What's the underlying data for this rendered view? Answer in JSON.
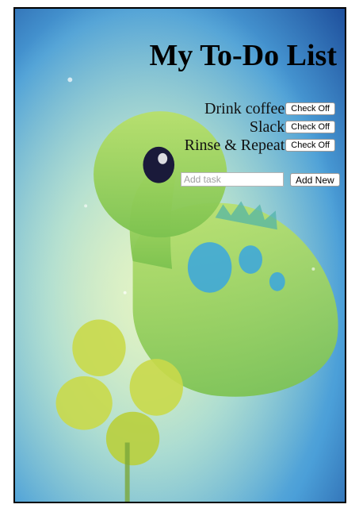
{
  "page": {
    "title": "My To-Do List",
    "background_colors": {
      "sky_light": "#cfe9b8",
      "sky_mid": "#8fd0d6",
      "sky_blue": "#4b9fd8",
      "sky_dark": "#1e4f9c",
      "dinosaur_green": "#a9d85a",
      "dinosaur_spots": "#3aa6df",
      "clover": "#c9d94a"
    }
  },
  "tasks": [
    {
      "label": "Drink coffee",
      "button": "Check Off"
    },
    {
      "label": "Slack",
      "button": "Check Off"
    },
    {
      "label": "Rinse & Repeat",
      "button": "Check Off"
    }
  ],
  "add_form": {
    "placeholder": "Add task",
    "value": "",
    "button_label": "Add New"
  }
}
